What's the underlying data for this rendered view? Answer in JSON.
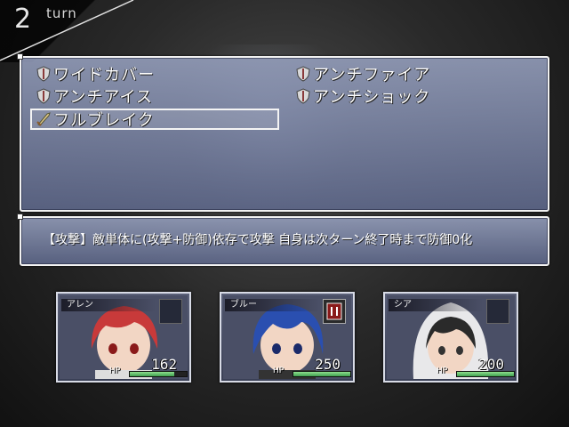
{
  "turn": {
    "number": "2",
    "label": "turn"
  },
  "skills": [
    {
      "label": "ワイドカバー",
      "icon": "shield-icon",
      "selected": false
    },
    {
      "label": "アンチファイア",
      "icon": "shield-icon",
      "selected": false
    },
    {
      "label": "アンチアイス",
      "icon": "shield-icon",
      "selected": false
    },
    {
      "label": "アンチショック",
      "icon": "shield-icon",
      "selected": false
    },
    {
      "label": "フルブレイク",
      "icon": "sword-icon",
      "selected": true
    }
  ],
  "help": {
    "text": "【攻撃】敵単体に(攻撃+防御)依存で攻撃 自身は次ターン終了時まで防御0化"
  },
  "party": [
    {
      "name": "アレン",
      "hp_label": "HP",
      "hp": "162",
      "hp_ratio": 0.78,
      "hair": "#c83a3a",
      "state_icon": ""
    },
    {
      "name": "ブルー",
      "hp_label": "HP",
      "hp": "250",
      "hp_ratio": 1.0,
      "hair": "#2a4fb0",
      "state_icon": "state-buff-icon"
    },
    {
      "name": "シア",
      "hp_label": "HP",
      "hp": "200",
      "hp_ratio": 1.0,
      "hair": "#2a2a2a",
      "state_icon": ""
    }
  ],
  "colors": {
    "window_top": "#969ebe",
    "window_bottom": "#5f698c",
    "hp_gauge": "#3f9f4f"
  }
}
